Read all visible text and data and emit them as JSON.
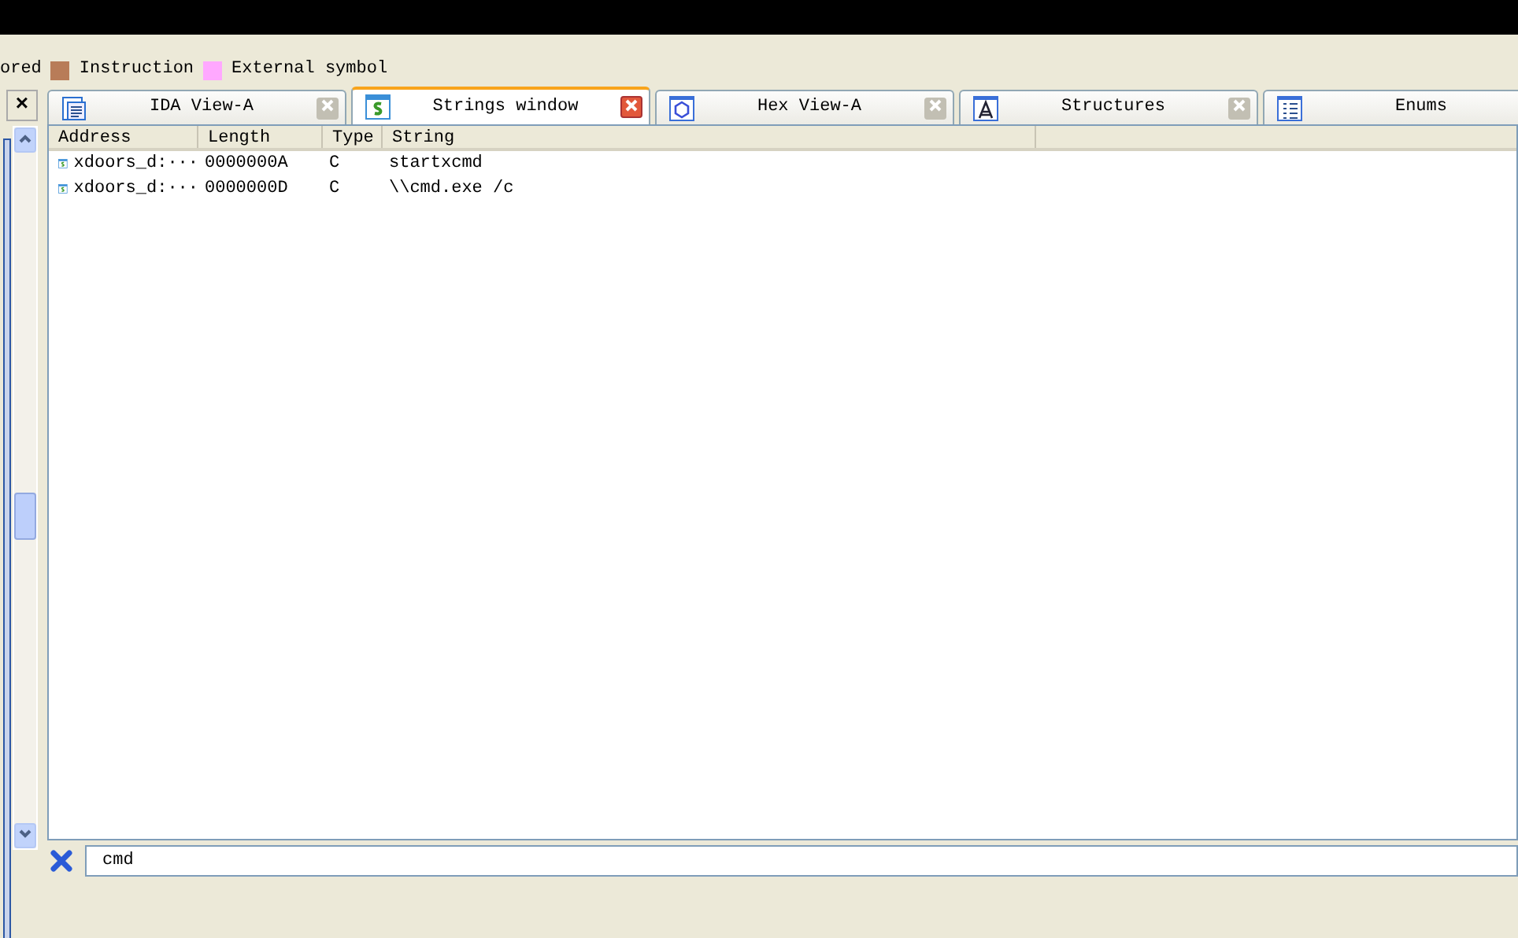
{
  "legend": [
    {
      "label": "ored"
    },
    {
      "label": "Instruction",
      "color": "#b87c58"
    },
    {
      "label": "External symbol",
      "color": "#ffa8ff"
    }
  ],
  "side_close": "×",
  "tabs": [
    {
      "label": "IDA View-A",
      "kind": "ida",
      "selected": false
    },
    {
      "label": "Strings window",
      "kind": "strings",
      "selected": true
    },
    {
      "label": "Hex View-A",
      "kind": "hex",
      "selected": false
    },
    {
      "label": "Structures",
      "kind": "struct",
      "selected": false
    },
    {
      "label": "Enums",
      "kind": "enums",
      "selected": false
    }
  ],
  "table": {
    "columns": [
      "Address",
      "Length",
      "Type",
      "String"
    ],
    "rows": [
      {
        "address": "xdoors_d:···",
        "length": "0000000A",
        "type": "C",
        "string": "startxcmd"
      },
      {
        "address": "xdoors_d:···",
        "length": "0000000D",
        "type": "C",
        "string": "\\\\cmd.exe /c"
      }
    ]
  },
  "filter": {
    "value": "cmd"
  }
}
